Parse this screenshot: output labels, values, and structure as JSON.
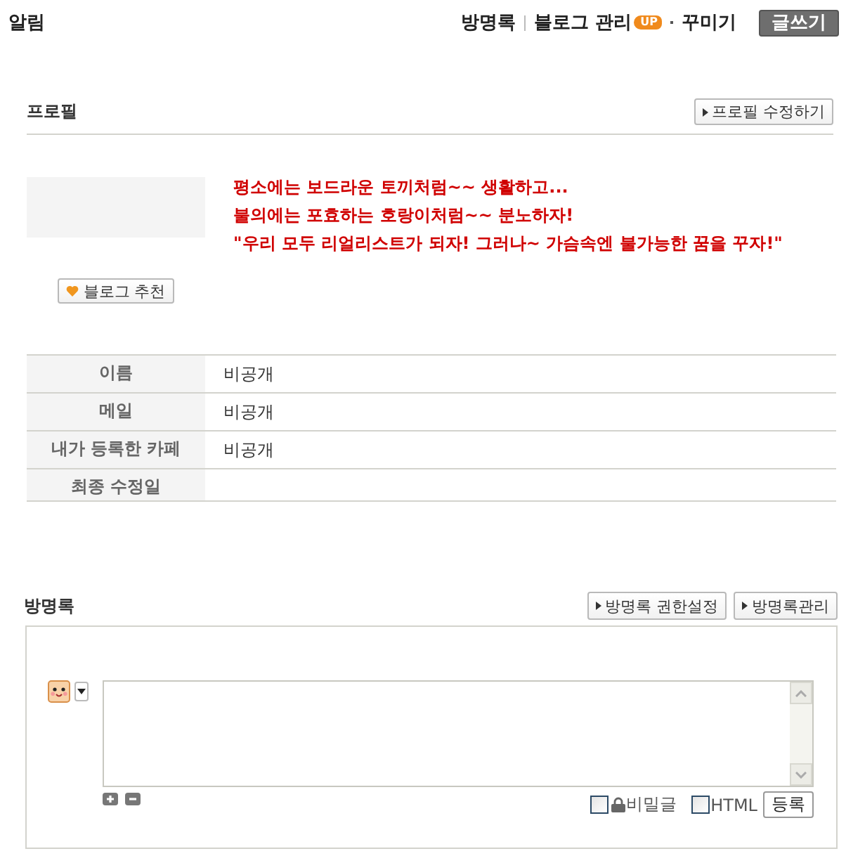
{
  "top_bar": {
    "title": "알림",
    "nav": [
      {
        "label": "방명록"
      },
      {
        "label": "블로그 관리",
        "badge": "UP"
      },
      {
        "label": "꾸미기"
      }
    ],
    "write_button": "글쓰기"
  },
  "profile": {
    "title": "프로필",
    "edit_button": "프로필 수정하기",
    "intro_lines": [
      "평소에는 보드라운 토끼처럼~~ 생활하고...",
      "불의에는 포효하는 호랑이처럼~~ 분노하자!",
      "\"우리 모두 리얼리스트가 되자! 그러나~ 가슴속엔 불가능한 꿈을 꾸자!\""
    ],
    "recommend_button": "블로그 추천",
    "info": [
      {
        "label": "이름",
        "value": "비공개"
      },
      {
        "label": "메일",
        "value": "비공개"
      },
      {
        "label": "내가 등록한 카페",
        "value": "비공개"
      },
      {
        "label": "최종 수정일"
      }
    ]
  },
  "guestbook": {
    "title": "방명록",
    "buttons": [
      "방명록 권한설정",
      "방명록관리"
    ],
    "options": [
      {
        "kind": "locked",
        "label": "비밀글",
        "checked": false
      },
      {
        "kind": "plain",
        "label": "HTML",
        "checked": false
      }
    ],
    "submit_button": "등록"
  }
}
